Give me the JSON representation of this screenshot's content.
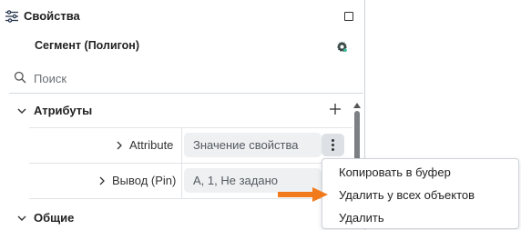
{
  "header": {
    "title": "Свойства"
  },
  "segment": {
    "title": "Сегмент (Полигон)"
  },
  "search": {
    "placeholder": "Поиск"
  },
  "sections": {
    "attributes": {
      "label": "Атрибуты"
    },
    "general": {
      "label": "Общие"
    }
  },
  "rows": [
    {
      "label": "Attribute",
      "value": "Значение свойства"
    },
    {
      "label": "Вывод (Pin)",
      "value": "A, 1, Не задано"
    }
  ],
  "context_menu": {
    "items": [
      "Копировать в буфер",
      "Удалить у всех объектов",
      "Удалить"
    ]
  },
  "colors": {
    "arrow": "#f07a1c",
    "field_bg": "#eef0f2",
    "gear": "#3a4a48"
  }
}
